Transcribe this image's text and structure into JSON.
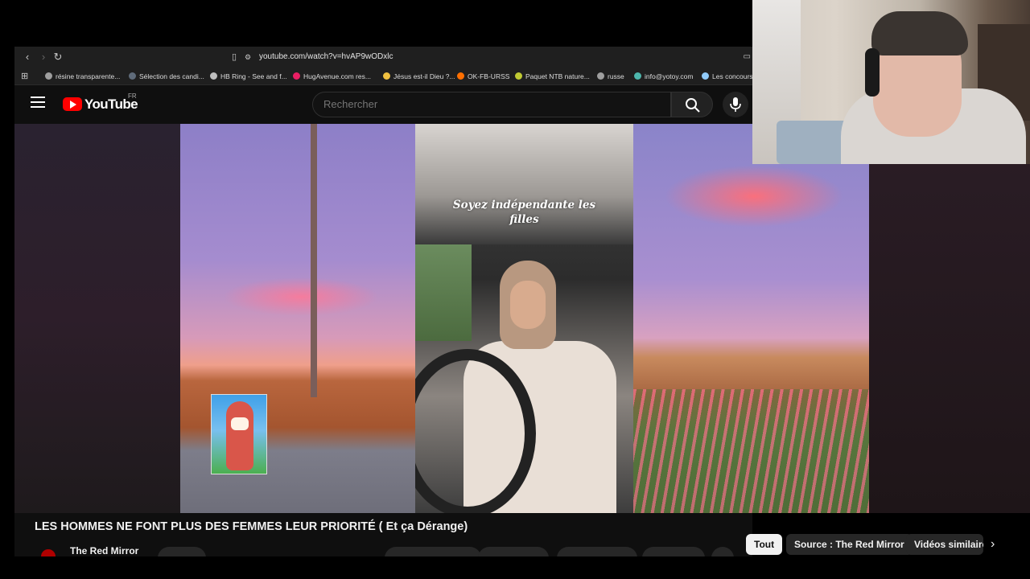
{
  "browser": {
    "url": "youtube.com/watch?v=hvAP9wODxlc",
    "bookmarks": [
      {
        "label": "résine transparente...",
        "color": "#9e9e9e"
      },
      {
        "label": "Sélection des candi...",
        "color": "#5f6b7a"
      },
      {
        "label": "HB Ring - See and f...",
        "color": "#bdbdbd"
      },
      {
        "label": "HugAvenue.com res...",
        "color": "#e91e63"
      },
      {
        "label": "Jésus est-il Dieu ?...",
        "color": "#f0c040"
      },
      {
        "label": "OK-FB-URSS",
        "color": "#ff6f00"
      },
      {
        "label": "Paquet NTB nature...",
        "color": "#c0ca33"
      },
      {
        "label": "russe",
        "color": "#9e9e9e"
      },
      {
        "label": "info@yotoy.com",
        "color": "#4db6ac"
      },
      {
        "label": "Les concours",
        "color": "#90caf9"
      }
    ]
  },
  "masthead": {
    "logo_text": "YouTube",
    "country": "FR",
    "search_placeholder": "Rechercher"
  },
  "video": {
    "overlay_text": "Soyez indépendante les filles",
    "title": "LES HOMMES NE FONT PLUS DES FEMMES LEUR PRIORITÉ ( Et ça Dérange)",
    "channel": "The Red Mirror"
  },
  "chips": {
    "all": "Tout",
    "source": "Source : The Red Mirror",
    "similar": "Vidéos similaires"
  },
  "colors": {
    "accent": "#ff0000",
    "background": "#0f0f0f"
  }
}
